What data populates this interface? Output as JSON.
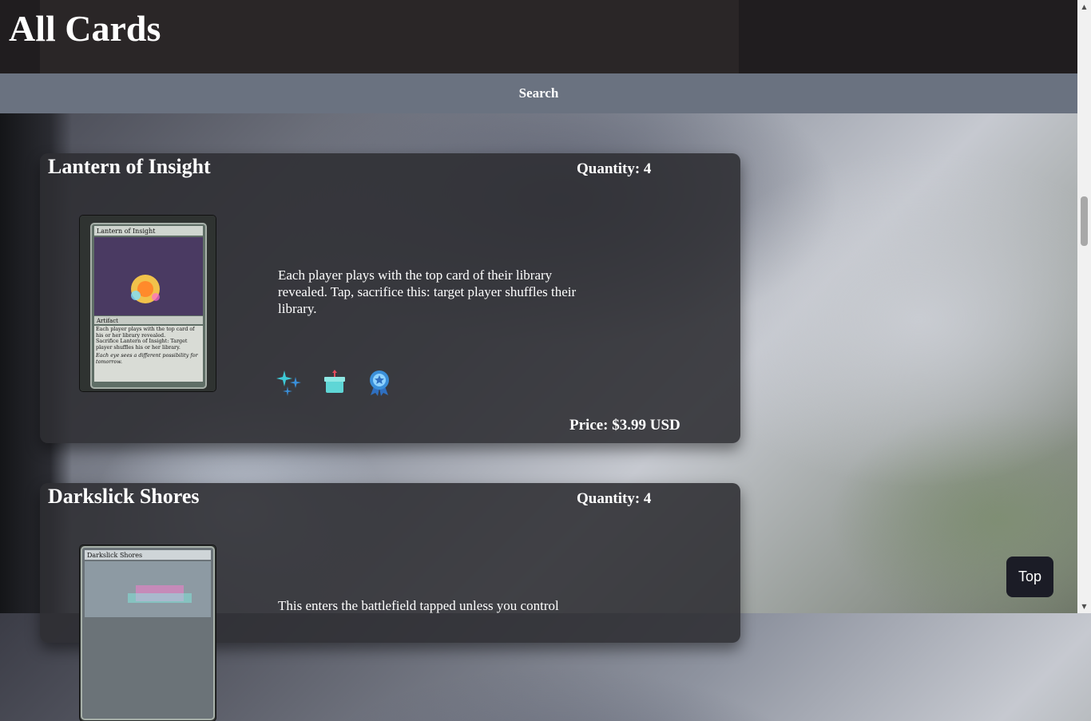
{
  "header": {
    "title": "All Cards"
  },
  "search": {
    "label": "Search"
  },
  "cards": [
    {
      "name": "Lantern of Insight",
      "quantity_label": "Quantity: 4",
      "image_title": "Lantern of Insight",
      "image_type": "Artifact",
      "image_rules": "Each player plays with the top card of his or her library revealed.",
      "image_ability": "Sacrifice Lantern of Insight: Target player shuffles his or her library.",
      "image_flavor": "Each eye sees a different possibility for tomorrow.",
      "description": "Each player plays with the top card of their library revealed. Tap, sacrifice this: target player shuffles their library.",
      "icons": [
        "sparkle-icon",
        "gift-box-icon",
        "award-badge-icon"
      ],
      "price_label": "Price: $3.99 USD"
    },
    {
      "name": "Darkslick Shores",
      "quantity_label": "Quantity: 4",
      "image_title": "Darkslick Shores",
      "description": "This enters the battlefield tapped unless you control"
    }
  ],
  "top_button": {
    "label": "Top"
  },
  "colors": {
    "header_bg": "#201d1f",
    "search_bg": "#6a7280",
    "card_bg": "#2d2d32",
    "icon_accent": "#3ec9d6"
  }
}
